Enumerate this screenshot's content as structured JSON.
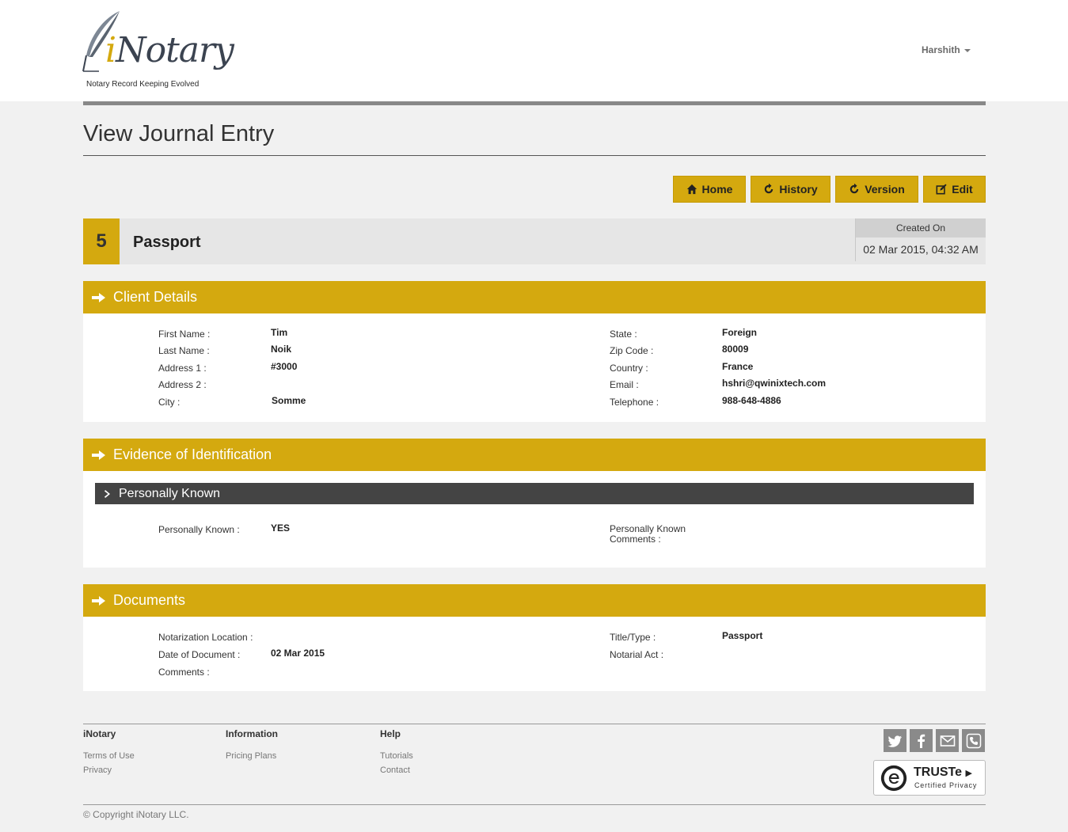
{
  "header": {
    "logo_text_i": "i",
    "logo_text_rest": "Notary",
    "logo_tagline": "Notary Record Keeping Evolved",
    "user_name": "Harshith"
  },
  "page": {
    "title": "View Journal Entry"
  },
  "toolbar": {
    "home_label": "Home",
    "history_label": "History",
    "version_label": "Version",
    "edit_label": "Edit"
  },
  "entry": {
    "number": "5",
    "type": "Passport",
    "created_label": "Created On",
    "created_value": "02 Mar 2015, 04:32 AM"
  },
  "client_details": {
    "heading": "Client Details",
    "first_name_label": "First Name :",
    "first_name": "Tim",
    "last_name_label": "Last Name :",
    "last_name": "Noik",
    "address1_label": "Address 1 :",
    "address1": "#3000",
    "address2_label": "Address 2 :",
    "address2": "",
    "city_label": "City :",
    "city": "Somme",
    "state_label": "State :",
    "state": "Foreign",
    "zip_label": "Zip Code :",
    "zip": "80009",
    "country_label": "Country :",
    "country": "France",
    "email_label": "Email :",
    "email": "hshri@qwinixtech.com",
    "telephone_label": "Telephone :",
    "telephone": "988-648-4886"
  },
  "evidence": {
    "heading": "Evidence of Identification",
    "subheading": "Personally Known",
    "known_label": "Personally Known :",
    "known_value": "YES",
    "comments_label_line1": "Personally Known",
    "comments_label_line2": "Comments :",
    "comments_value": ""
  },
  "documents": {
    "heading": "Documents",
    "location_label": "Notarization Location :",
    "location_value": "",
    "date_label": "Date of Document :",
    "date_value": "02 Mar 2015",
    "comments_label": "Comments :",
    "comments_value": "",
    "title_label": "Title/Type :",
    "title_value": "Passport",
    "act_label": "Notarial Act :",
    "act_value": ""
  },
  "footer": {
    "col1_heading": "iNotary",
    "col1_links": [
      "Terms of Use",
      "Privacy"
    ],
    "col2_heading": "Information",
    "col2_links": [
      "Pricing Plans"
    ],
    "col3_heading": "Help",
    "col3_links": [
      "Tutorials",
      "Contact"
    ],
    "social_icons": [
      "twitter-icon",
      "facebook-icon",
      "email-icon",
      "phone-icon"
    ],
    "truste_name": "TRUSTe",
    "truste_sub": "Certified Privacy",
    "copyright": "© Copyright iNotary LLC."
  },
  "colors": {
    "accent": "#d4a90f",
    "dark_subheader": "#444444",
    "page_background": "#f1f1f1"
  }
}
